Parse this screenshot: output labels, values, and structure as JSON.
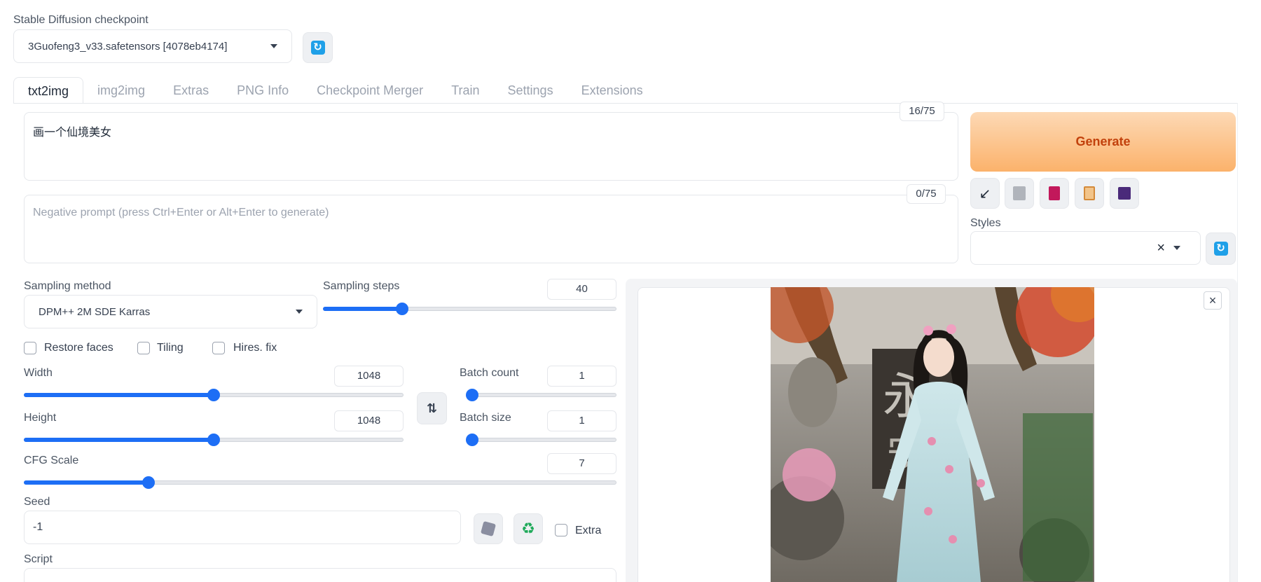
{
  "checkpoint": {
    "label": "Stable Diffusion checkpoint",
    "value": "3Guofeng3_v33.safetensors [4078eb4174]",
    "refresh_icon": "refresh-icon"
  },
  "tabs": [
    "txt2img",
    "img2img",
    "Extras",
    "PNG Info",
    "Checkpoint Merger",
    "Train",
    "Settings",
    "Extensions"
  ],
  "prompt": {
    "value": "画一个仙境美女",
    "counter": "16/75"
  },
  "negative_prompt": {
    "placeholder": "Negative prompt (press Ctrl+Enter or Alt+Enter to generate)",
    "counter": "0/75"
  },
  "generate_label": "Generate",
  "tools": [
    "arrow-icon",
    "trash-icon",
    "book-icon",
    "clipboard-icon",
    "save-icon"
  ],
  "styles": {
    "label": "Styles",
    "clear": "×"
  },
  "sampling": {
    "method_label": "Sampling method",
    "method_value": "DPM++ 2M SDE Karras",
    "steps_label": "Sampling steps",
    "steps_value": "40",
    "steps_fraction": 0.27
  },
  "checkboxes": {
    "restore_faces": "Restore faces",
    "tiling": "Tiling",
    "hires_fix": "Hires. fix"
  },
  "width": {
    "label": "Width",
    "value": "1048",
    "fraction": 0.5
  },
  "height": {
    "label": "Height",
    "value": "1048",
    "fraction": 0.5
  },
  "swap_icon": "swap-icon",
  "batch_count": {
    "label": "Batch count",
    "value": "1",
    "fraction": 0.0
  },
  "batch_size": {
    "label": "Batch size",
    "value": "1",
    "fraction": 0.0
  },
  "cfg": {
    "label": "CFG Scale",
    "value": "7",
    "fraction": 0.21
  },
  "seed": {
    "label": "Seed",
    "value": "-1",
    "extra_label": "Extra",
    "dice_icon": "dice-icon",
    "recycle_icon": "recycle-icon"
  },
  "script": {
    "label": "Script"
  },
  "output": {
    "close": "×"
  }
}
